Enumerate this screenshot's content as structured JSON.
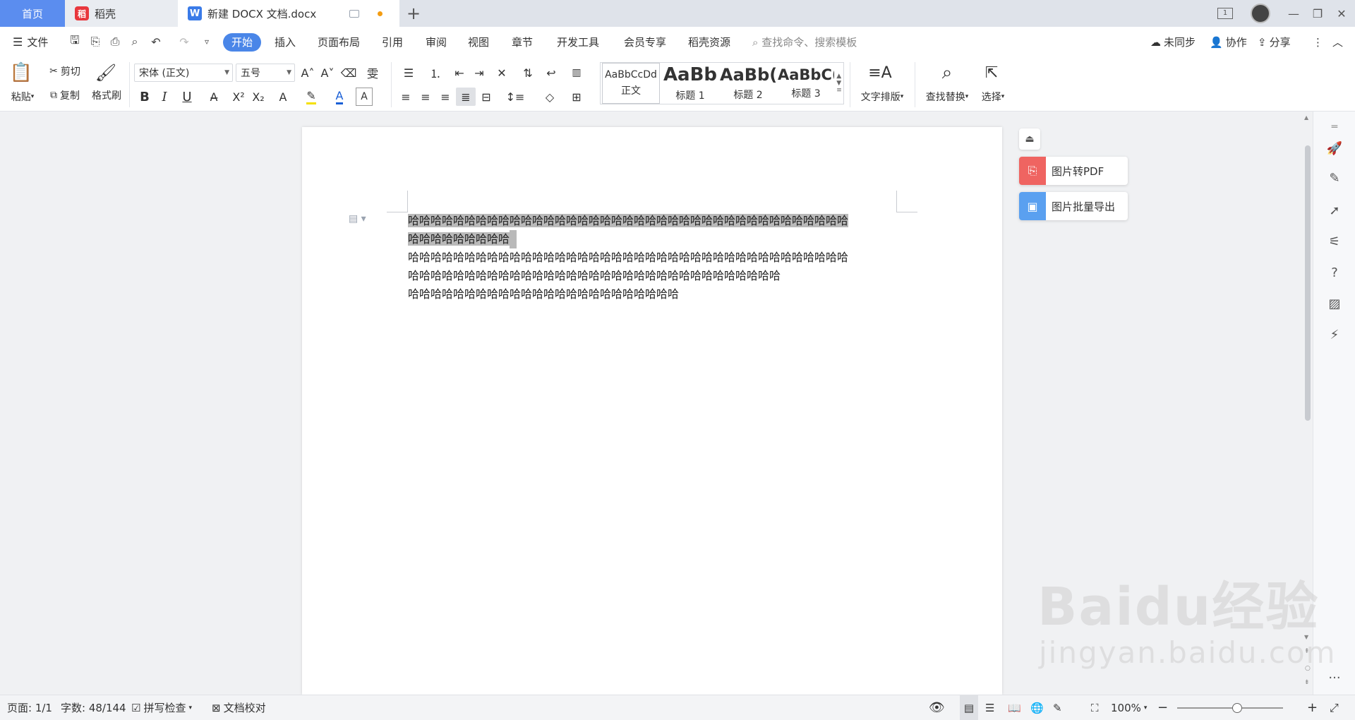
{
  "tabs": {
    "home": "首页",
    "daoke": "稻壳",
    "document": "新建 DOCX 文档.docx",
    "add": "+"
  },
  "window": {
    "badge": "1",
    "minimize": "—",
    "restore": "❐",
    "close": "✕"
  },
  "menu": {
    "file": "文件",
    "items": [
      "开始",
      "插入",
      "页面布局",
      "引用",
      "审阅",
      "视图",
      "章节",
      "开发工具",
      "会员专享",
      "稻壳资源"
    ],
    "search_placeholder": "查找命令、搜索模板",
    "sync": "未同步",
    "collab": "协作",
    "share": "分享"
  },
  "toolbar": {
    "paste": "粘贴",
    "cut": "剪切",
    "copy": "复制",
    "format_painter": "格式刷",
    "font_name": "宋体 (正文)",
    "font_size": "五号",
    "bold": "B",
    "italic": "I",
    "underline": "U",
    "styles": [
      {
        "sample": "AaBbCcDd",
        "label": "正文"
      },
      {
        "sample": "AaBb",
        "label": "标题 1"
      },
      {
        "sample": "AaBb(",
        "label": "标题 2"
      },
      {
        "sample": "AaBbC(",
        "label": "标题 3"
      }
    ],
    "text_layout": "文字排版",
    "find_replace": "查找替换",
    "select": "选择"
  },
  "document": {
    "lines": [
      "哈哈哈哈哈哈哈哈哈哈哈哈哈哈哈哈哈哈哈哈哈哈哈哈哈哈哈哈哈哈哈哈哈哈哈哈哈哈哈",
      "哈哈哈哈哈哈哈哈哈",
      "哈哈哈哈哈哈哈哈哈哈哈哈哈哈哈哈哈哈哈哈哈哈哈哈哈哈哈哈哈哈哈哈哈哈哈哈哈哈哈",
      "哈哈哈哈哈哈哈哈哈哈哈哈哈哈哈哈哈哈哈哈哈哈哈哈哈哈哈哈哈哈哈哈哈",
      "哈哈哈哈哈哈哈哈哈哈哈哈哈哈哈哈哈哈哈哈哈哈哈哈"
    ]
  },
  "side_panel": {
    "img_to_pdf": "图片转PDF",
    "img_batch_export": "图片批量导出"
  },
  "status": {
    "page": "页面: 1/1",
    "word_count": "字数: 48/144",
    "spell_check": "拼写检查",
    "doc_proof": "文档校对",
    "zoom": "100%"
  },
  "colors": {
    "accent": "#4a86e8",
    "home_tab": "#5b8def",
    "selection": "#b9b9b9"
  },
  "watermark": {
    "brand": "Baidu经验",
    "url": "jingyan.baidu.com"
  }
}
